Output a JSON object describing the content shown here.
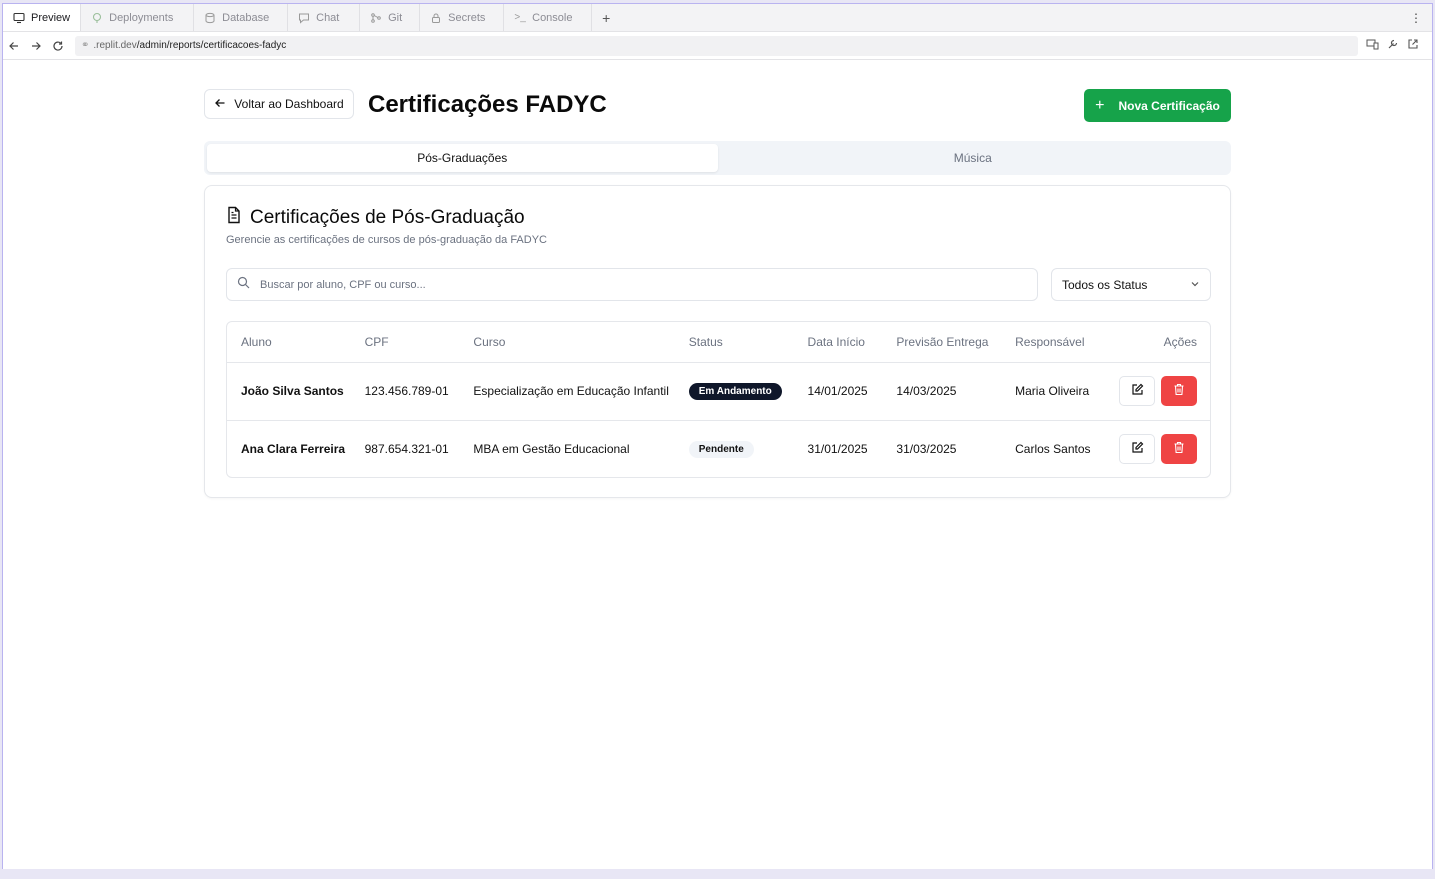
{
  "browser": {
    "tabs": [
      {
        "label": "Preview",
        "icon": "monitor-icon",
        "active": true
      },
      {
        "label": "Deployments",
        "icon": "deploy-icon",
        "active": false
      },
      {
        "label": "Database",
        "icon": "database-icon",
        "active": false
      },
      {
        "label": "Chat",
        "icon": "chat-icon",
        "active": false
      },
      {
        "label": "Git",
        "icon": "git-icon",
        "active": false
      },
      {
        "label": "Secrets",
        "icon": "lock-icon",
        "active": false
      },
      {
        "label": "Console",
        "icon": "terminal-icon",
        "active": false
      }
    ],
    "url_host": ".replit.dev",
    "url_path": "/admin/reports/certificacoes-fadyc"
  },
  "header": {
    "back_label": "Voltar ao Dashboard",
    "title": "Certificações FADYC",
    "new_label": "Nova Certificação"
  },
  "tabs": {
    "pos": "Pós-Graduações",
    "musica": "Música"
  },
  "card": {
    "title": "Certificações de Pós-Graduação",
    "subtitle": "Gerencie as certificações de cursos de pós-graduação da FADYC",
    "search_placeholder": "Buscar por aluno, CPF ou curso...",
    "status_filter": "Todos os Status"
  },
  "table": {
    "headers": {
      "aluno": "Aluno",
      "cpf": "CPF",
      "curso": "Curso",
      "status": "Status",
      "inicio": "Data Início",
      "previsao": "Previsão Entrega",
      "responsavel": "Responsável",
      "acoes": "Ações"
    },
    "rows": [
      {
        "aluno": "João Silva Santos",
        "cpf": "123.456.789-01",
        "curso": "Especialização em Educação Infantil",
        "status": "Em Andamento",
        "inicio": "14/01/2025",
        "previsao": "14/03/2025",
        "responsavel": "Maria Oliveira"
      },
      {
        "aluno": "Ana Clara Ferreira",
        "cpf": "987.654.321-01",
        "curso": "MBA em Gestão Educacional",
        "status": "Pendente",
        "inicio": "31/01/2025",
        "previsao": "31/03/2025",
        "responsavel": "Carlos Santos"
      }
    ]
  },
  "colors": {
    "primary_green": "#16a34a",
    "danger_red": "#ef4444",
    "badge_dark": "#0f172a"
  }
}
